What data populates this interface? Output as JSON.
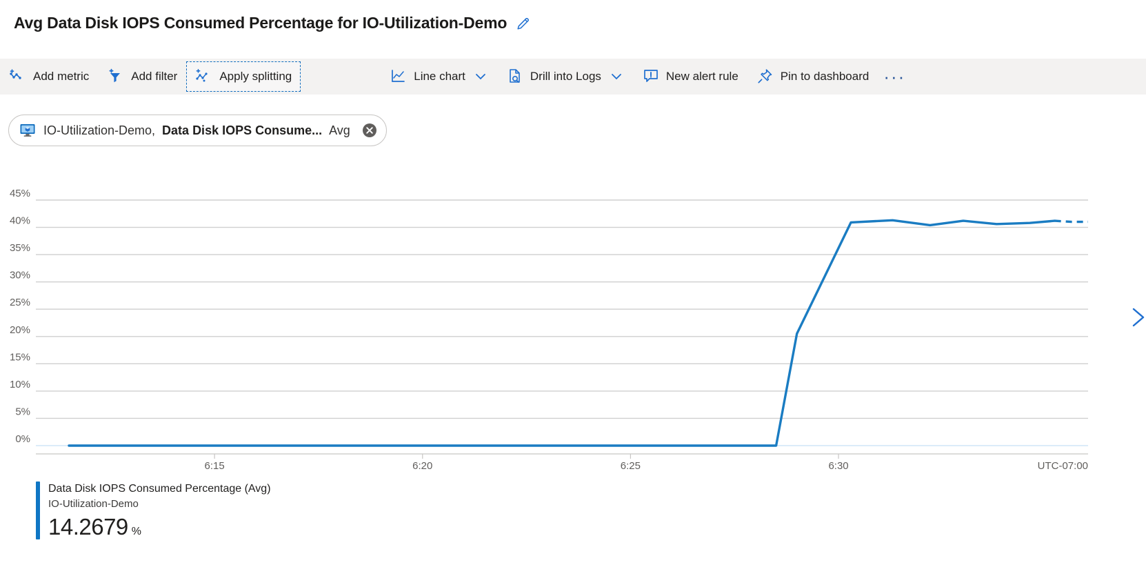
{
  "header": {
    "title": "Avg Data Disk IOPS Consumed Percentage for IO-Utilization-Demo",
    "edit_icon": "pencil-icon"
  },
  "toolbar": {
    "items": [
      {
        "label": "Add metric",
        "icon": "add-metric-icon",
        "caret": false,
        "focused": false
      },
      {
        "label": "Add filter",
        "icon": "add-filter-icon",
        "caret": false,
        "focused": false
      },
      {
        "label": "Apply splitting",
        "icon": "apply-splitting-icon",
        "caret": false,
        "focused": true
      },
      {
        "label": "Line chart",
        "icon": "line-chart-icon",
        "caret": true,
        "focused": false
      },
      {
        "label": "Drill into Logs",
        "icon": "drill-logs-icon",
        "caret": true,
        "focused": false
      },
      {
        "label": "New alert rule",
        "icon": "alert-rule-icon",
        "caret": false,
        "focused": false
      },
      {
        "label": "Pin to dashboard",
        "icon": "pin-icon",
        "caret": false,
        "focused": false
      }
    ],
    "overflow_label": "···"
  },
  "metric_chip": {
    "resource": "IO-Utilization-Demo,",
    "metric": "Data Disk IOPS Consume...",
    "aggregation": "Avg",
    "resource_icon": "virtual-machine-icon",
    "close_icon": "close-icon"
  },
  "legend": {
    "metric_name": "Data Disk IOPS Consumed Percentage (Avg)",
    "resource_name": "IO-Utilization-Demo",
    "value": "14.2679",
    "unit": "%",
    "color": "#0f76c4"
  },
  "nav": {
    "next_icon": "chevron-right-icon"
  },
  "colors": {
    "series": "#1a7cc2",
    "gridline": "#cfcfcf",
    "axis_text": "#605e5c",
    "toolbar_bg": "#f3f2f1",
    "accent": "#0f6cbd"
  },
  "chart_data": {
    "type": "line",
    "title": "Avg Data Disk IOPS Consumed Percentage for IO-Utilization-Demo",
    "xlabel": "",
    "ylabel": "",
    "timezone": "UTC-07:00",
    "ylim": [
      0,
      45
    ],
    "yticks": [
      0,
      5,
      10,
      15,
      20,
      25,
      30,
      35,
      40,
      45
    ],
    "ytick_labels": [
      "0%",
      "5%",
      "10%",
      "15%",
      "20%",
      "25%",
      "30%",
      "35%",
      "40%",
      "45%"
    ],
    "grid": true,
    "legend_position": "bottom-left",
    "xticks": [
      "6:15",
      "6:20",
      "6:25",
      "6:30"
    ],
    "xtick_positions_min": [
      15,
      20,
      25,
      30
    ],
    "xlim_min": [
      11.5,
      36.0
    ],
    "series": [
      {
        "name": "Data Disk IOPS Consumed Percentage (Avg)",
        "resource": "IO-Utilization-Demo",
        "color": "#1a7cc2",
        "current_value": 14.2679,
        "x_minutes": [
          11.5,
          13,
          14,
          15,
          16,
          17,
          18,
          19,
          20,
          21,
          22,
          23,
          24,
          25,
          26,
          27,
          28,
          28.5,
          29,
          30.3,
          31.3,
          32.2,
          33.0,
          33.8,
          34.6,
          35.2
        ],
        "values": [
          0,
          0,
          0,
          0,
          0,
          0,
          0,
          0,
          0,
          0,
          0,
          0,
          0,
          0,
          0,
          0,
          0,
          0,
          20.5,
          40.9,
          41.3,
          40.4,
          41.2,
          40.6,
          40.8,
          41.2
        ],
        "dashed_tail": {
          "x_minutes": [
            35.2,
            35.6,
            36.0
          ],
          "values": [
            41.2,
            41.0,
            41.0
          ],
          "note": "projected / partial-bucket segment rendered dashed"
        }
      }
    ]
  }
}
